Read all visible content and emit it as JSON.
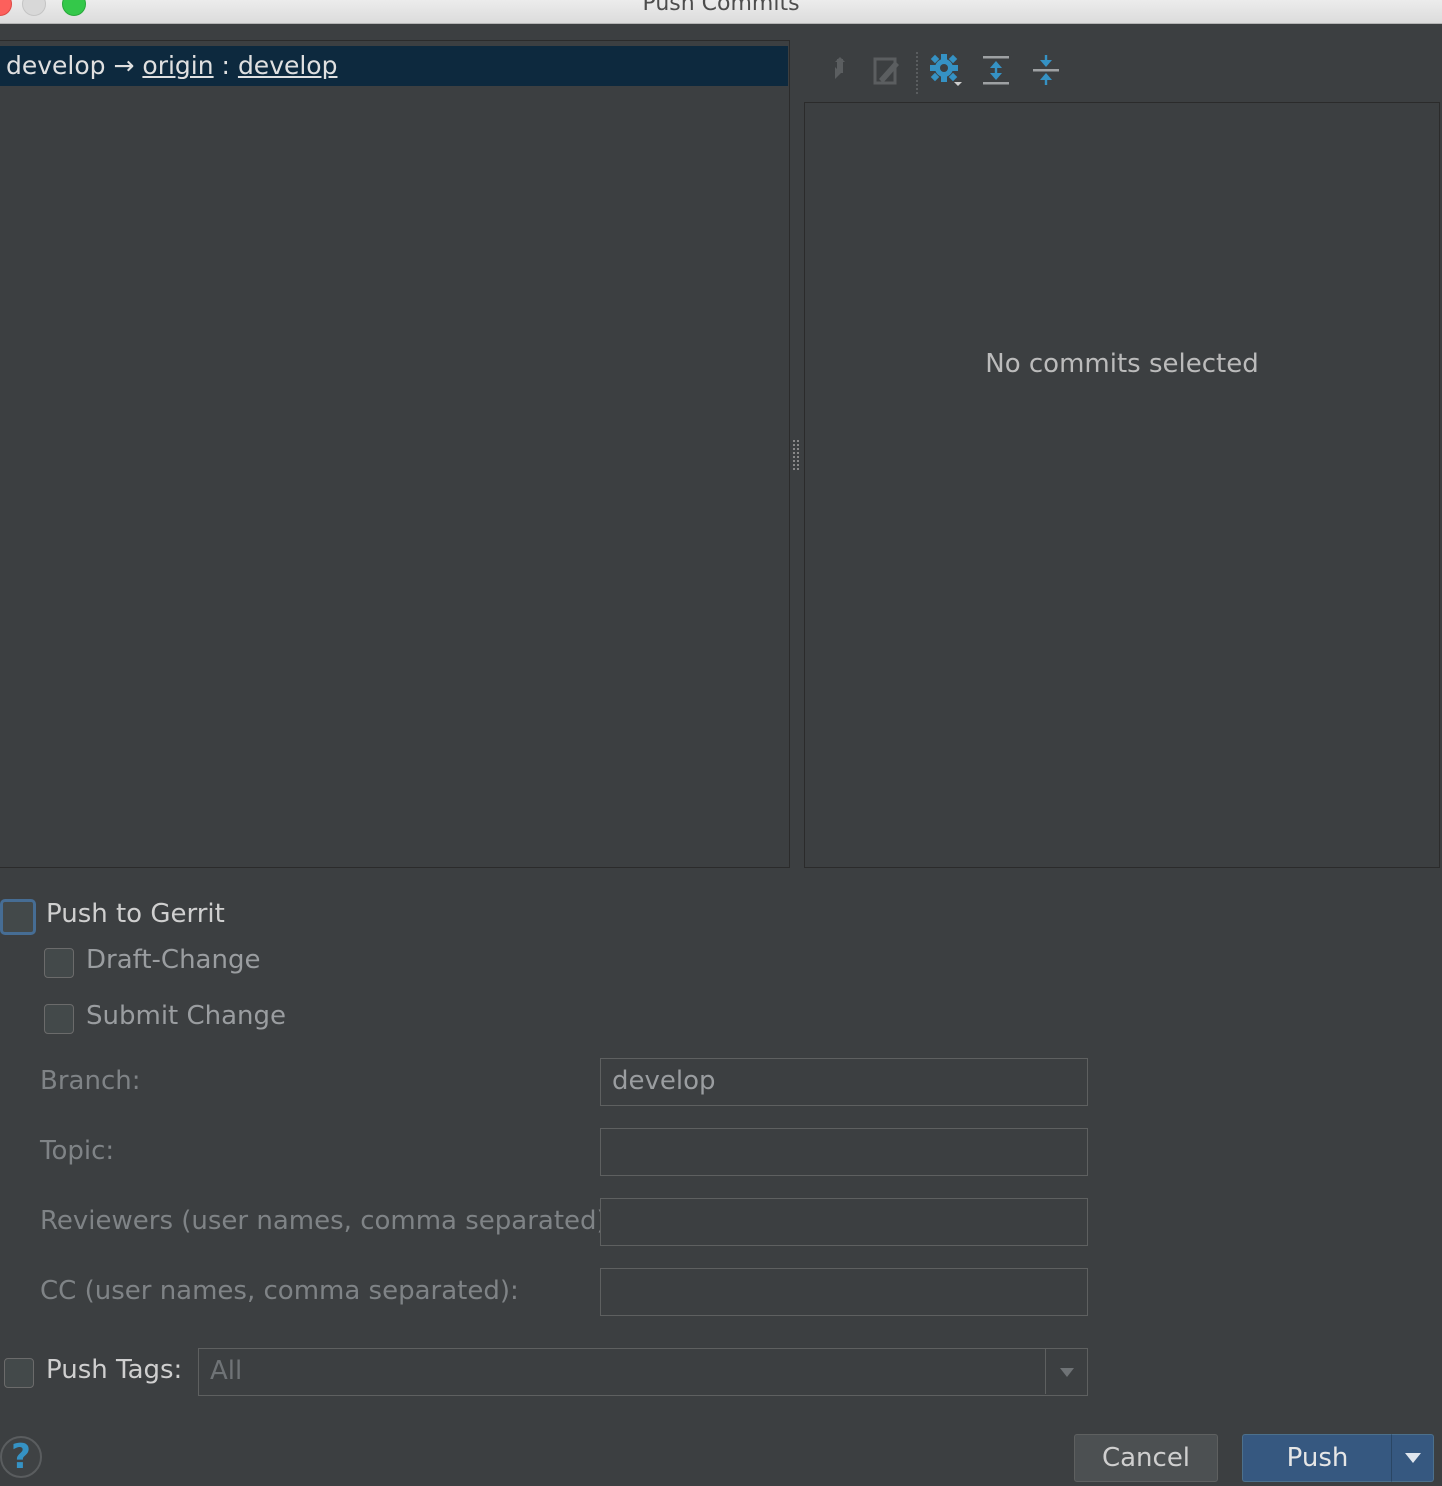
{
  "window": {
    "title": "Push Commits"
  },
  "branch": {
    "local": "develop",
    "arrow": "→",
    "remote": "origin",
    "separator": ":",
    "target": "develop"
  },
  "toolbar": {
    "icons": [
      "merge-arrow-icon",
      "edit-source-icon",
      "gear-icon",
      "expand-all-icon",
      "collapse-all-icon"
    ]
  },
  "details": {
    "empty_text": "No commits selected"
  },
  "gerrit": {
    "push_to_gerrit": "Push to Gerrit",
    "draft_change": "Draft-Change",
    "submit_change": "Submit Change",
    "branch_label": "Branch:",
    "branch_value": "develop",
    "topic_label": "Topic:",
    "topic_value": "",
    "reviewers_label": "Reviewers (user names, comma separated):",
    "reviewers_value": "",
    "cc_label": "CC (user names, comma separated):",
    "cc_value": ""
  },
  "tags": {
    "label": "Push Tags:",
    "selected": "All"
  },
  "footer": {
    "help": "?",
    "cancel": "Cancel",
    "push": "Push"
  },
  "colors": {
    "background": "#3c3f41",
    "selection": "#0d293e",
    "accent_blue": "#3592c4",
    "push_button": "#365880"
  }
}
